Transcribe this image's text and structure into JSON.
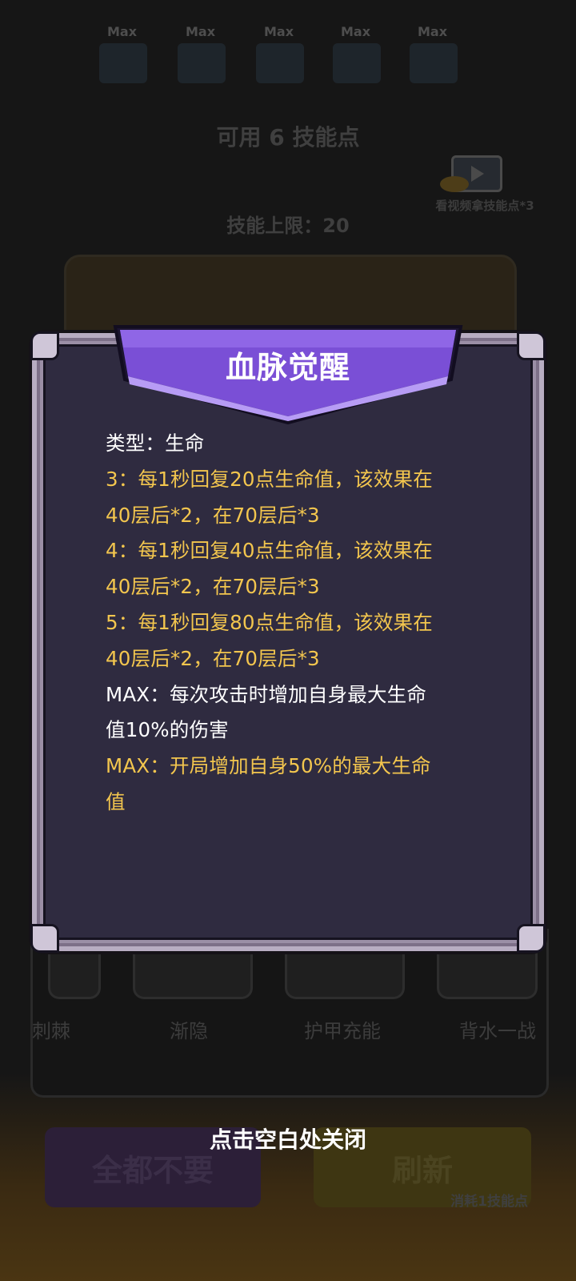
{
  "background": {
    "skill_points_available": "可用 6 技能点",
    "skill_limit": "技能上限：20",
    "video_reward_label": "看视频拿技能点*3",
    "max_tags": [
      "Max",
      "Max",
      "Max",
      "Max",
      "Max"
    ],
    "tiles": [
      "刺棘",
      "渐隐",
      "护甲充能",
      "背水一战"
    ],
    "buttons": {
      "reject_all": "全都不要",
      "refresh": "刷新",
      "refresh_cost": "消耗1技能点"
    }
  },
  "modal": {
    "title": "血脉觉醒",
    "lines": [
      {
        "text": "类型：生命",
        "color": "white"
      },
      {
        "text": "3：每1秒回复20点生命值，该效果在",
        "color": "gold"
      },
      {
        "text": "40层后*2，在70层后*3",
        "color": "gold"
      },
      {
        "text": "4：每1秒回复40点生命值，该效果在",
        "color": "gold"
      },
      {
        "text": "40层后*2，在70层后*3",
        "color": "gold"
      },
      {
        "text": "5：每1秒回复80点生命值，该效果在",
        "color": "gold"
      },
      {
        "text": "40层后*2，在70层后*3",
        "color": "gold"
      },
      {
        "text": "MAX：每次攻击时增加自身最大生命",
        "color": "white"
      },
      {
        "text": "值10%的伤害",
        "color": "white"
      },
      {
        "text": "MAX：开局增加自身50%的最大生命",
        "color": "gold"
      },
      {
        "text": "值",
        "color": "gold"
      }
    ]
  },
  "close_hint": "点击空白处关闭",
  "colors": {
    "gold_text": "#f3c64e",
    "banner_purple": "#7a4fd6",
    "panel_bg": "#2f2b40"
  }
}
